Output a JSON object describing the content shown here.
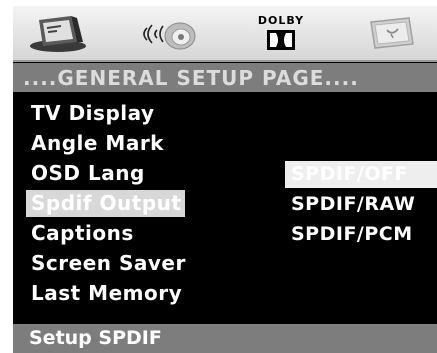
{
  "icons": [
    {
      "name": "general-setup-icon"
    },
    {
      "name": "audio-setup-icon"
    },
    {
      "name": "dolby-digital-icon",
      "label": "DOLBY"
    },
    {
      "name": "preference-icon"
    }
  ],
  "header": {
    "title": "....GENERAL SETUP PAGE...."
  },
  "menu": {
    "items": [
      {
        "label": "TV Display"
      },
      {
        "label": "Angle Mark"
      },
      {
        "label": "OSD Lang"
      },
      {
        "label": "Spdif Output",
        "selected": true
      },
      {
        "label": "Captions"
      },
      {
        "label": "Screen Saver"
      },
      {
        "label": "Last Memory"
      }
    ]
  },
  "submenu": {
    "options": [
      {
        "label": "SPDIF/OFF",
        "selected": true
      },
      {
        "label": "SPDIF/RAW"
      },
      {
        "label": "SPDIF/PCM"
      }
    ]
  },
  "footer": {
    "hint": "Setup SPDIF"
  },
  "colors": {
    "background": "#000000",
    "band": "#7d7d7d",
    "highlight": "#d8d8d8",
    "text": "#ffffff"
  }
}
